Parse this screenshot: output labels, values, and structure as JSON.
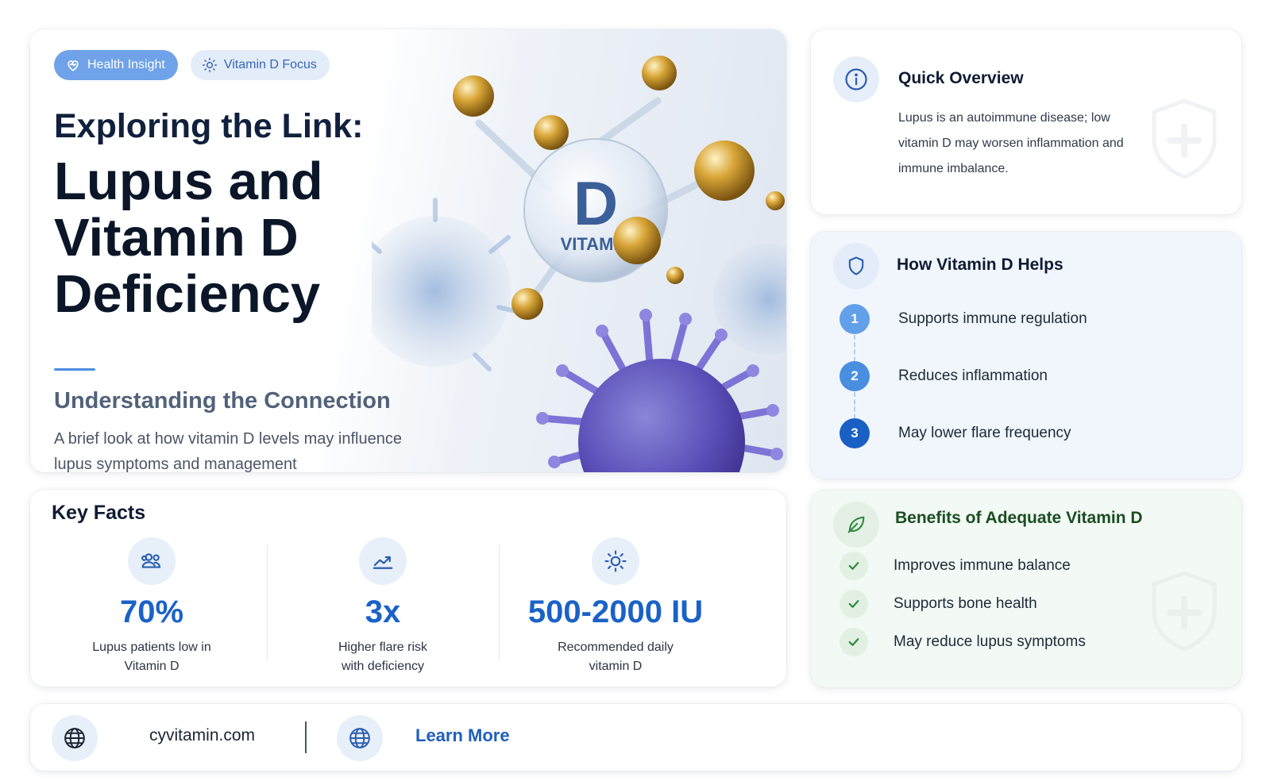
{
  "hero": {
    "chips": [
      {
        "label": "Health Insight",
        "icon": "heart-icon"
      },
      {
        "label": "Vitamin D Focus",
        "icon": "sun-icon"
      }
    ],
    "kicker": "Exploring the Link:",
    "headline": "Lupus and Vitamin D Deficiency",
    "subhead": "Understanding the Connection",
    "description": "A brief look at how vitamin D levels may influence lupus symptoms and management",
    "illustration": {
      "letter": "D",
      "word": "VITAMIN"
    }
  },
  "overview": {
    "title": "Quick Overview",
    "icon": "info-icon",
    "body": "Lupus is an autoimmune disease; low vitamin D may worsen inflammation and immune imbalance."
  },
  "helps": {
    "title": "How Vitamin D Helps",
    "icon": "shield-icon",
    "steps": [
      {
        "num": "1",
        "label": "Supports immune regulation"
      },
      {
        "num": "2",
        "label": "Reduces inflammation"
      },
      {
        "num": "3",
        "label": "May lower flare frequency"
      }
    ]
  },
  "benefits": {
    "title": "Benefits of Adequate Vitamin D",
    "icon": "leaf-icon",
    "items": [
      {
        "label": "Improves immune balance"
      },
      {
        "label": "Supports bone health"
      },
      {
        "label": "May reduce lupus symptoms"
      }
    ]
  },
  "facts": {
    "title": "Key Facts",
    "items": [
      {
        "value": "70%",
        "desc": "Lupus patients low in Vitamin D",
        "icon": "people-icon"
      },
      {
        "value": "3x",
        "desc": "Higher flare risk with deficiency",
        "icon": "trend-up-icon"
      },
      {
        "value": "500-2000 IU",
        "desc": "Recommended daily vitamin D",
        "icon": "sun-icon"
      }
    ]
  },
  "footer": {
    "site": "cyvitamin.com",
    "cta": "Learn More",
    "icon": "globe-icon"
  },
  "colors": {
    "accent": "#1a62c7",
    "chip_primary": "#6fa2e8",
    "step_1": "#62a0ea",
    "step_2": "#4a8ee0",
    "step_3": "#1a5fc4",
    "benefit_green": "#2e8b3e"
  }
}
